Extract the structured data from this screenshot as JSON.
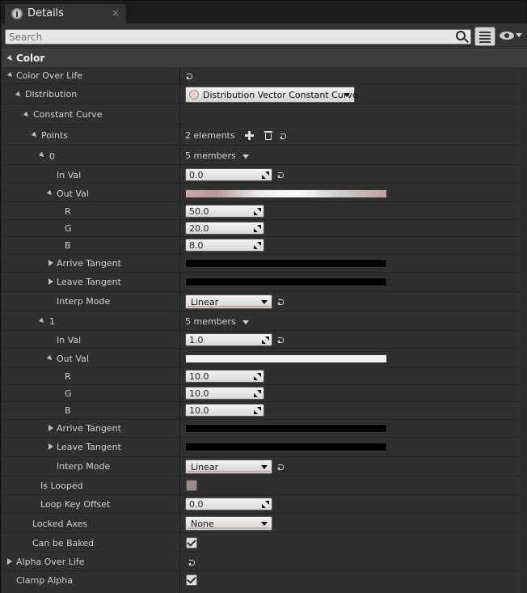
{
  "tab": {
    "title": "Details",
    "close": "×"
  },
  "search": {
    "placeholder": "Search"
  },
  "category": {
    "title": "Color"
  },
  "rows": {
    "color_over_life": "Color Over Life",
    "distribution": "Distribution",
    "distribution_value": "Distribution Vector Constant Curve",
    "constant_curve": "Constant Curve",
    "points": "Points",
    "points_count": "2 elements",
    "p0_index": "0",
    "p0_members": "5 members",
    "p0_in_val_label": "In Val",
    "p0_in_val": "0.0",
    "p0_out_val_label": "Out Val",
    "p0_r_label": "R",
    "p0_r": "50.0",
    "p0_g_label": "G",
    "p0_g": "20.0",
    "p0_b_label": "B",
    "p0_b": "8.0",
    "p0_arrive": "Arrive Tangent",
    "p0_leave": "Leave Tangent",
    "p0_interp_label": "Interp Mode",
    "p0_interp": "Linear",
    "p1_index": "1",
    "p1_members": "5 members",
    "p1_in_val_label": "In Val",
    "p1_in_val": "1.0",
    "p1_out_val_label": "Out Val",
    "p1_r_label": "R",
    "p1_r": "10.0",
    "p1_g_label": "G",
    "p1_g": "10.0",
    "p1_b_label": "B",
    "p1_b": "10.0",
    "p1_arrive": "Arrive Tangent",
    "p1_leave": "Leave Tangent",
    "p1_interp_label": "Interp Mode",
    "p1_interp": "Linear",
    "is_looped": "Is Looped",
    "loop_key_offset": "Loop Key Offset",
    "loop_key_offset_value": "0.0",
    "locked_axes": "Locked Axes",
    "locked_axes_value": "None",
    "can_be_baked": "Can be Baked",
    "alpha_over_life": "Alpha Over Life",
    "clamp_alpha": "Clamp Alpha"
  },
  "colors": {
    "panel_bg": "#2f2f2f",
    "header_bg": "#3c3c3c",
    "p0_out_val_gradient": "linear-gradient(90deg,#c8a8a8 0%,#b89898 15%,#e8e8e8 35%,#ffffff 55%,#d0d0d0 75%,#c0a0a0 100%)",
    "p1_out_val_color": "#f2f2f2",
    "tangent_color": "#000000"
  },
  "icons": [
    "info-icon",
    "close-icon",
    "search-icon",
    "list-view-icon",
    "eye-icon",
    "reset-icon",
    "plus-icon",
    "trash-icon",
    "checkbox-icon"
  ]
}
